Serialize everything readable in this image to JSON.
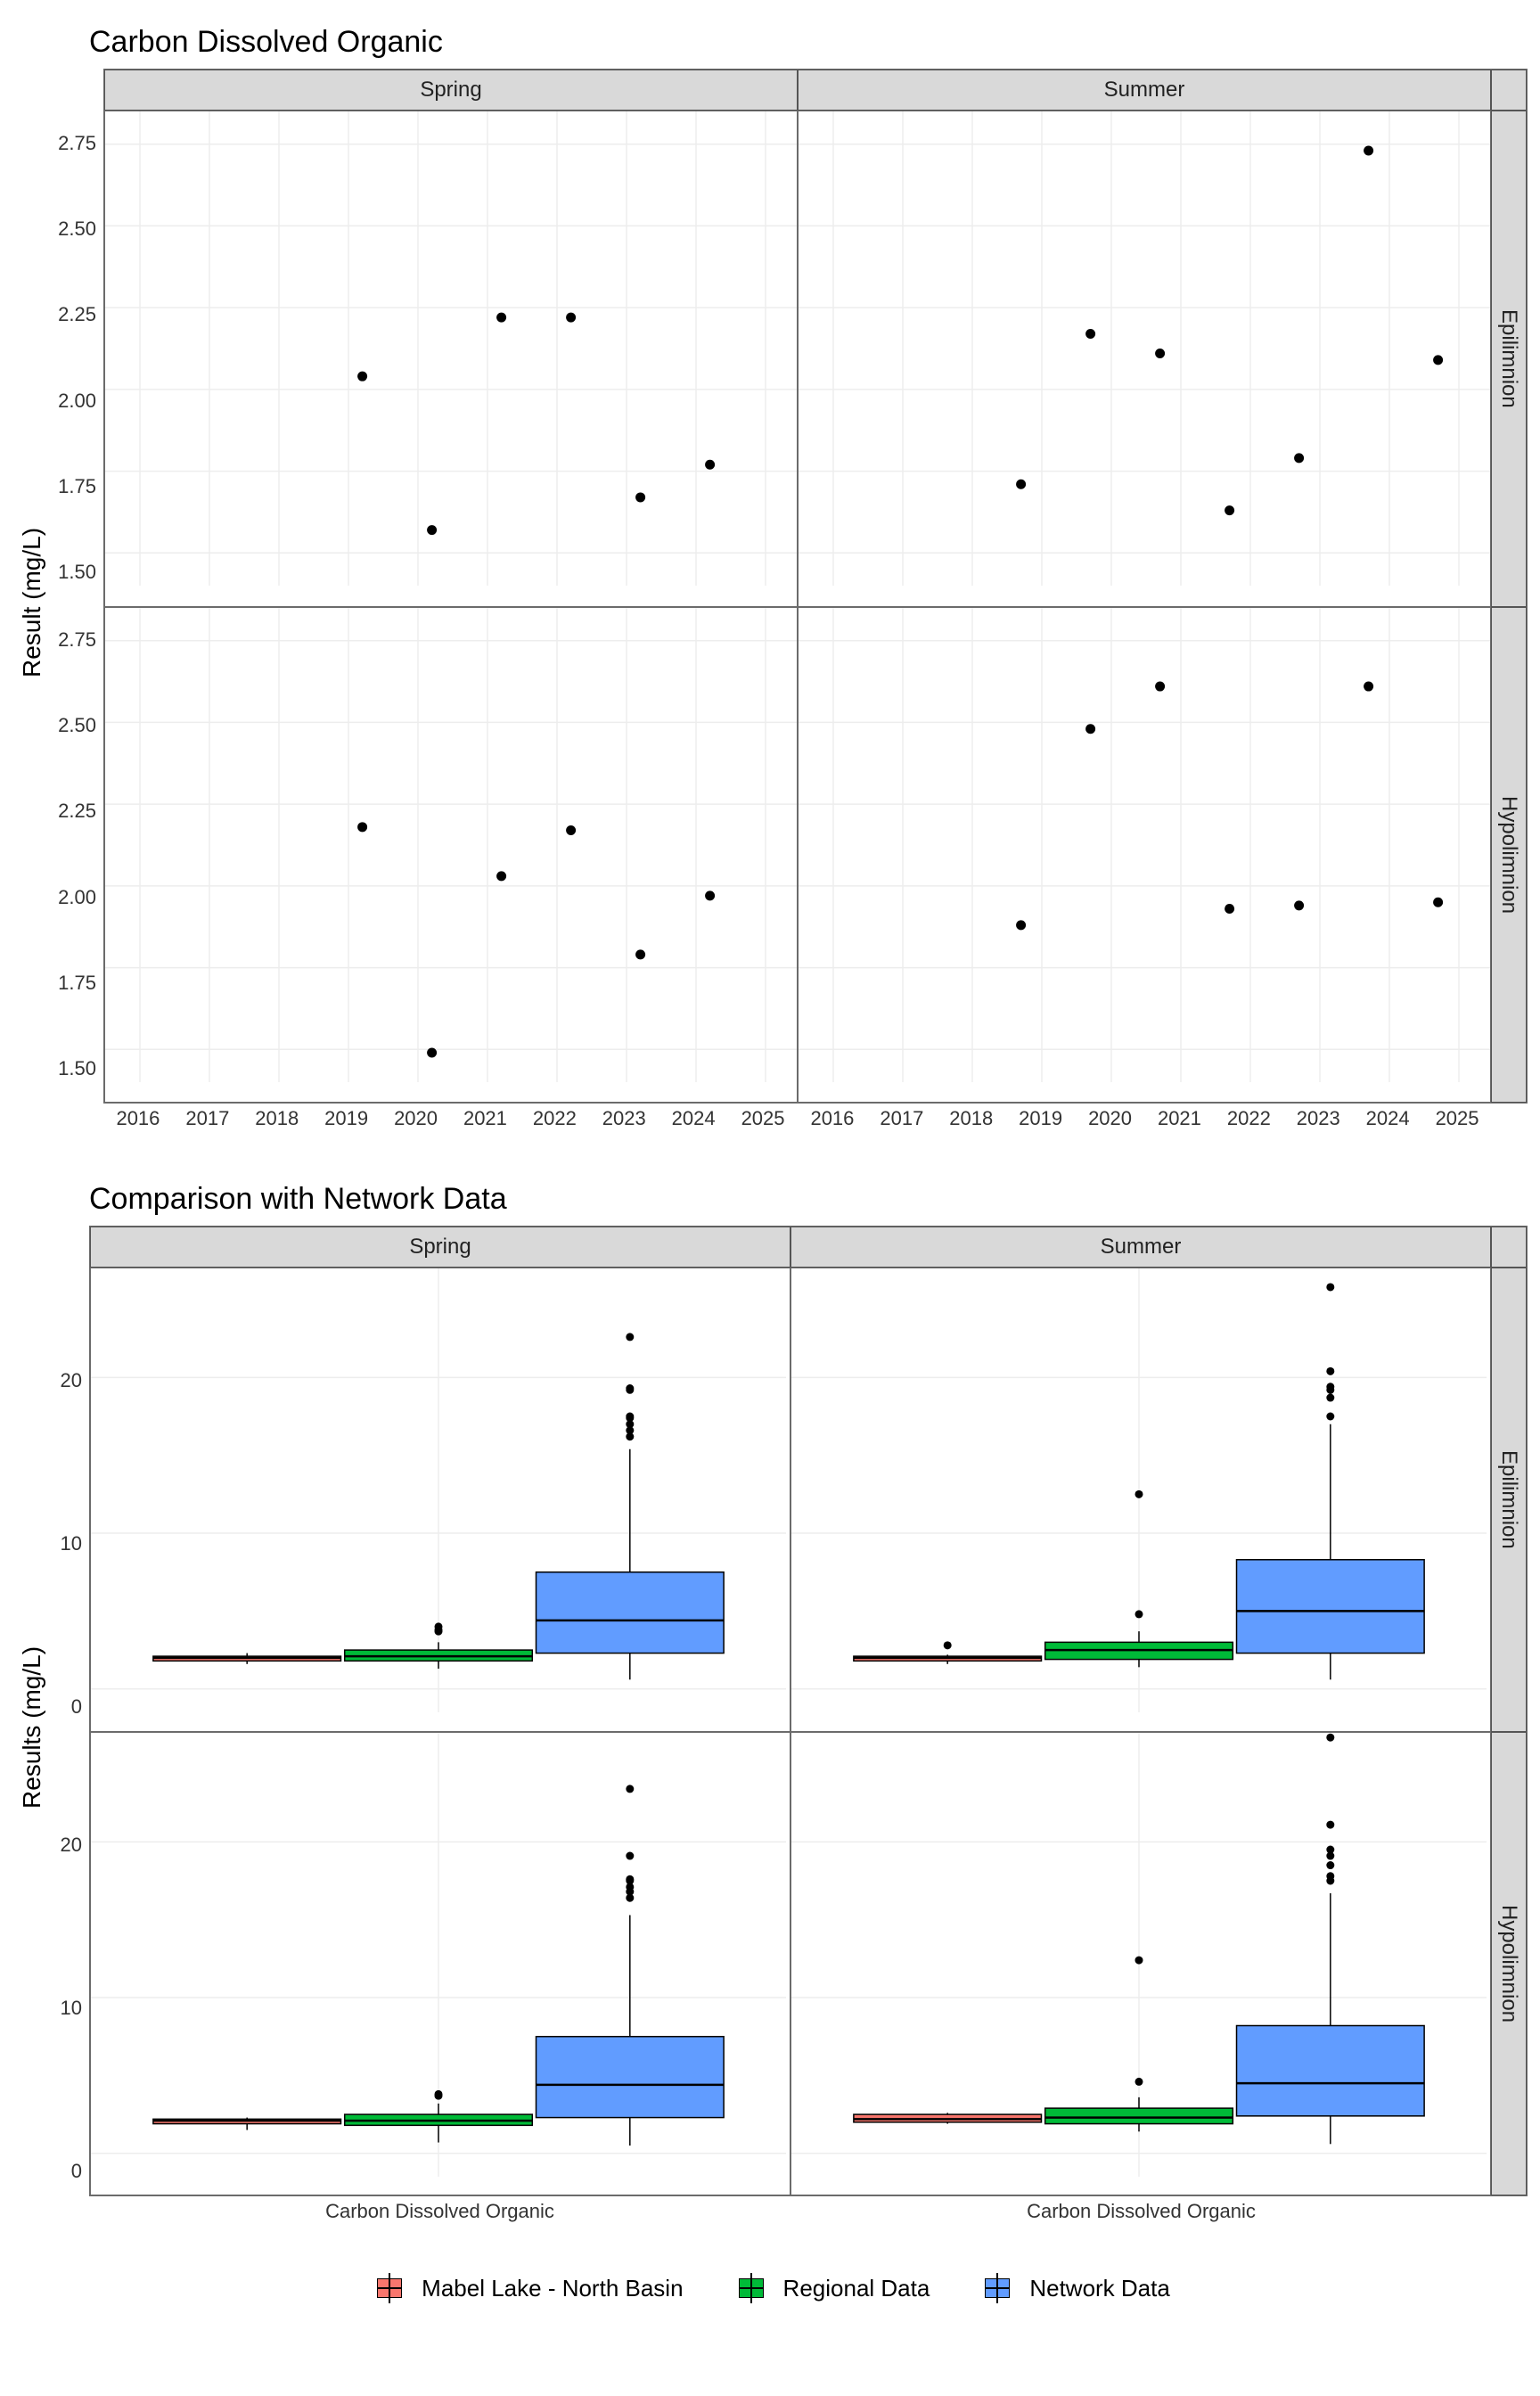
{
  "chart_data": [
    {
      "id": "scatter",
      "type": "scatter",
      "title": "Carbon Dissolved Organic",
      "xlabel": "",
      "ylabel": "Result (mg/L)",
      "x_breaks": [
        2016,
        2017,
        2018,
        2019,
        2020,
        2021,
        2022,
        2023,
        2024,
        2025
      ],
      "y_breaks": [
        1.5,
        1.75,
        2.0,
        2.25,
        2.5,
        2.75
      ],
      "xlim": [
        2015.5,
        2025.5
      ],
      "ylim": [
        1.4,
        2.85
      ],
      "col_facets": [
        "Spring",
        "Summer"
      ],
      "row_facets": [
        "Epilimnion",
        "Hypolimnion"
      ],
      "panels": {
        "Spring|Epilimnion": [
          {
            "x": 2019.2,
            "y": 2.04
          },
          {
            "x": 2020.2,
            "y": 1.57
          },
          {
            "x": 2021.2,
            "y": 2.22
          },
          {
            "x": 2022.2,
            "y": 2.22
          },
          {
            "x": 2023.2,
            "y": 1.67
          },
          {
            "x": 2024.2,
            "y": 1.77
          }
        ],
        "Summer|Epilimnion": [
          {
            "x": 2018.7,
            "y": 1.71
          },
          {
            "x": 2019.7,
            "y": 2.17
          },
          {
            "x": 2020.7,
            "y": 2.11
          },
          {
            "x": 2021.7,
            "y": 1.63
          },
          {
            "x": 2022.7,
            "y": 1.79
          },
          {
            "x": 2023.7,
            "y": 2.73
          },
          {
            "x": 2024.7,
            "y": 2.09
          }
        ],
        "Spring|Hypolimnion": [
          {
            "x": 2019.2,
            "y": 2.18
          },
          {
            "x": 2020.2,
            "y": 1.49
          },
          {
            "x": 2021.2,
            "y": 2.03
          },
          {
            "x": 2022.2,
            "y": 2.17
          },
          {
            "x": 2023.2,
            "y": 1.79
          },
          {
            "x": 2024.2,
            "y": 1.97
          }
        ],
        "Summer|Hypolimnion": [
          {
            "x": 2018.7,
            "y": 1.88
          },
          {
            "x": 2019.7,
            "y": 2.48
          },
          {
            "x": 2020.7,
            "y": 2.61
          },
          {
            "x": 2021.7,
            "y": 1.93
          },
          {
            "x": 2022.7,
            "y": 1.94
          },
          {
            "x": 2023.7,
            "y": 2.61
          },
          {
            "x": 2024.7,
            "y": 1.95
          }
        ]
      }
    },
    {
      "id": "box",
      "type": "boxplot",
      "title": "Comparison with Network Data",
      "xlabel": "",
      "ylabel": "Results (mg/L)",
      "x_categories": [
        "Carbon Dissolved Organic"
      ],
      "y_breaks": [
        0,
        10,
        20
      ],
      "ylim": [
        -1.5,
        27
      ],
      "col_facets": [
        "Spring",
        "Summer"
      ],
      "row_facets": [
        "Epilimnion",
        "Hypolimnion"
      ],
      "series": [
        {
          "name": "Mabel Lake - North Basin",
          "color": "#F8766D"
        },
        {
          "name": "Regional Data",
          "color": "#00BA38"
        },
        {
          "name": "Network Data",
          "color": "#619CFF"
        }
      ],
      "panels": {
        "Spring|Epilimnion": [
          {
            "series": "Mabel Lake - North Basin",
            "lower_whisker": 1.6,
            "q1": 1.8,
            "median": 2.0,
            "q3": 2.1,
            "upper_whisker": 2.3,
            "outliers": []
          },
          {
            "series": "Regional Data",
            "lower_whisker": 1.3,
            "q1": 1.8,
            "median": 2.1,
            "q3": 2.5,
            "upper_whisker": 3.0,
            "outliers": [
              3.7,
              3.8,
              4.0
            ]
          },
          {
            "series": "Network Data",
            "lower_whisker": 0.6,
            "q1": 2.3,
            "median": 4.4,
            "q3": 7.5,
            "upper_whisker": 15.4,
            "outliers": [
              16.2,
              16.6,
              17.0,
              17.4,
              17.5,
              19.2,
              19.3,
              22.6
            ]
          }
        ],
        "Summer|Epilimnion": [
          {
            "series": "Mabel Lake - North Basin",
            "lower_whisker": 1.6,
            "q1": 1.8,
            "median": 2.0,
            "q3": 2.1,
            "upper_whisker": 2.2,
            "outliers": [
              2.8
            ]
          },
          {
            "series": "Regional Data",
            "lower_whisker": 1.4,
            "q1": 1.9,
            "median": 2.5,
            "q3": 3.0,
            "upper_whisker": 3.7,
            "outliers": [
              4.8,
              12.5
            ]
          },
          {
            "series": "Network Data",
            "lower_whisker": 0.6,
            "q1": 2.3,
            "median": 5.0,
            "q3": 8.3,
            "upper_whisker": 17.0,
            "outliers": [
              17.5,
              18.7,
              19.2,
              19.4,
              20.4,
              25.8
            ]
          }
        ],
        "Spring|Hypolimnion": [
          {
            "series": "Mabel Lake - North Basin",
            "lower_whisker": 1.5,
            "q1": 1.9,
            "median": 2.1,
            "q3": 2.2,
            "upper_whisker": 2.3,
            "outliers": []
          },
          {
            "series": "Regional Data",
            "lower_whisker": 0.7,
            "q1": 1.8,
            "median": 2.1,
            "q3": 2.5,
            "upper_whisker": 3.2,
            "outliers": [
              3.7,
              3.8
            ]
          },
          {
            "series": "Network Data",
            "lower_whisker": 0.5,
            "q1": 2.3,
            "median": 4.4,
            "q3": 7.5,
            "upper_whisker": 15.3,
            "outliers": [
              16.4,
              16.8,
              17.1,
              17.5,
              17.6,
              19.1,
              23.4
            ]
          }
        ],
        "Summer|Hypolimnion": [
          {
            "series": "Mabel Lake - North Basin",
            "lower_whisker": 1.9,
            "q1": 2.0,
            "median": 2.2,
            "q3": 2.5,
            "upper_whisker": 2.6,
            "outliers": []
          },
          {
            "series": "Regional Data",
            "lower_whisker": 1.4,
            "q1": 1.9,
            "median": 2.3,
            "q3": 2.9,
            "upper_whisker": 3.6,
            "outliers": [
              4.6,
              12.4
            ]
          },
          {
            "series": "Network Data",
            "lower_whisker": 0.6,
            "q1": 2.4,
            "median": 4.5,
            "q3": 8.2,
            "upper_whisker": 16.7,
            "outliers": [
              17.5,
              17.8,
              18.5,
              19.1,
              19.5,
              21.1,
              26.7
            ]
          }
        ]
      }
    }
  ],
  "legend": {
    "items": [
      {
        "label": "Mabel Lake - North Basin",
        "color": "#F8766D"
      },
      {
        "label": "Regional Data",
        "color": "#00BA38"
      },
      {
        "label": "Network Data",
        "color": "#619CFF"
      }
    ]
  }
}
